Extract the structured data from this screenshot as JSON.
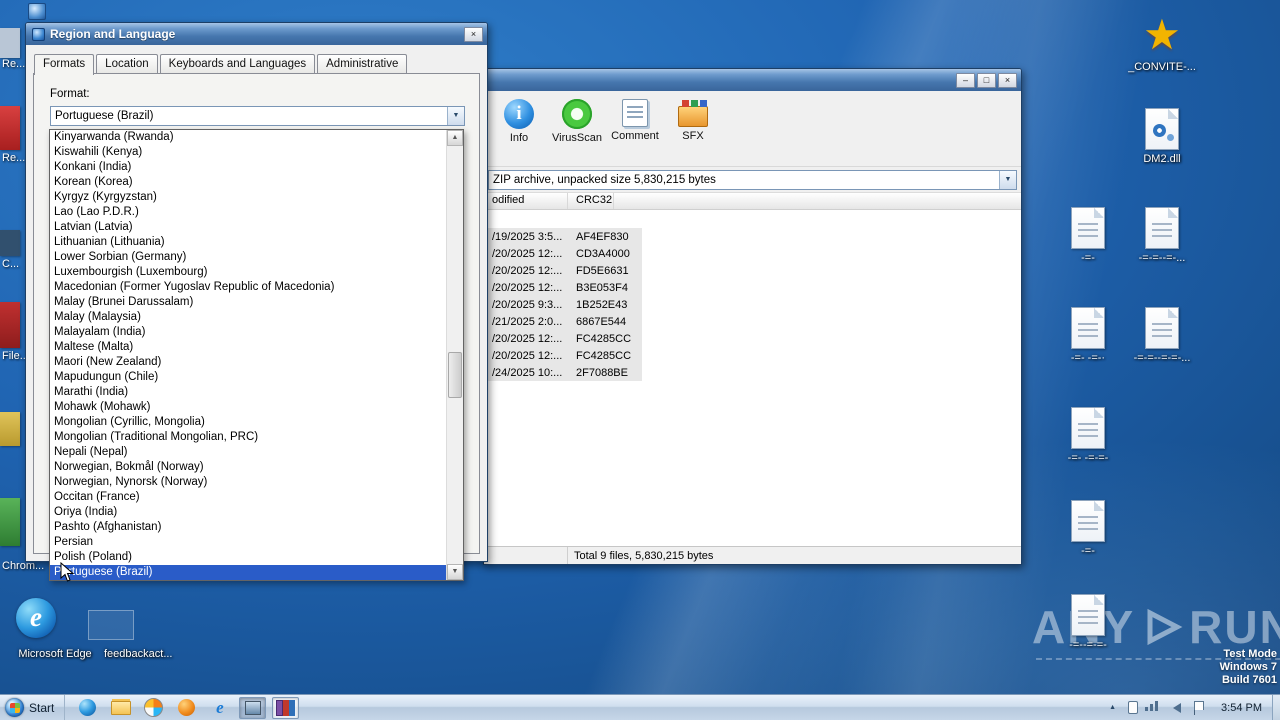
{
  "colors": {
    "desktop_blue": "#1f63b1",
    "selection_blue": "#2a5cc8",
    "titlebar_blue": "#4677ae",
    "taskbar_light": "#cfdeee"
  },
  "region_dialog": {
    "title": "Region and Language",
    "close_glyph": "×",
    "tabs": [
      {
        "label": "Formats"
      },
      {
        "label": "Location"
      },
      {
        "label": "Keyboards and Languages"
      },
      {
        "label": "Administrative"
      }
    ],
    "format_label": "Format:",
    "combo_value": "Portuguese (Brazil)",
    "combo_arrow": "▼",
    "scroll_up": "▲",
    "scroll_down": "▼",
    "list_items": [
      {
        "label": "Kinyarwanda (Rwanda)"
      },
      {
        "label": "Kiswahili (Kenya)"
      },
      {
        "label": "Konkani (India)"
      },
      {
        "label": "Korean (Korea)"
      },
      {
        "label": "Kyrgyz (Kyrgyzstan)"
      },
      {
        "label": "Lao (Lao P.D.R.)"
      },
      {
        "label": "Latvian (Latvia)"
      },
      {
        "label": "Lithuanian (Lithuania)"
      },
      {
        "label": "Lower Sorbian (Germany)"
      },
      {
        "label": "Luxembourgish (Luxembourg)"
      },
      {
        "label": "Macedonian (Former Yugoslav Republic of Macedonia)"
      },
      {
        "label": "Malay (Brunei Darussalam)"
      },
      {
        "label": "Malay (Malaysia)"
      },
      {
        "label": "Malayalam (India)"
      },
      {
        "label": "Maltese (Malta)"
      },
      {
        "label": "Maori (New Zealand)"
      },
      {
        "label": "Mapudungun (Chile)"
      },
      {
        "label": "Marathi (India)"
      },
      {
        "label": "Mohawk (Mohawk)"
      },
      {
        "label": "Mongolian (Cyrillic, Mongolia)"
      },
      {
        "label": "Mongolian (Traditional Mongolian, PRC)"
      },
      {
        "label": "Nepali (Nepal)"
      },
      {
        "label": "Norwegian, Bokmål (Norway)"
      },
      {
        "label": "Norwegian, Nynorsk (Norway)"
      },
      {
        "label": "Occitan (France)"
      },
      {
        "label": "Oriya (India)"
      },
      {
        "label": "Pashto (Afghanistan)"
      },
      {
        "label": "Persian"
      },
      {
        "label": "Polish (Poland)"
      },
      {
        "label": "Portuguese (Brazil)",
        "state": "selected"
      }
    ]
  },
  "archive_window": {
    "window_buttons": {
      "minimize": "–",
      "maximize": "□",
      "close": "×"
    },
    "toolbar": [
      {
        "label": "Info"
      },
      {
        "label": "VirusScan"
      },
      {
        "label": "Comment"
      },
      {
        "label": "SFX"
      }
    ],
    "address_value": "ZIP archive, unpacked size 5,830,215 bytes",
    "address_arrow": "▼",
    "columns": [
      {
        "label": "odified"
      },
      {
        "label": "CRC32"
      }
    ],
    "rows": [
      {
        "modified": "/19/2025 3:5...",
        "crc": "AF4EF830"
      },
      {
        "modified": "/20/2025 12:...",
        "crc": "CD3A4000"
      },
      {
        "modified": "/20/2025 12:...",
        "crc": "FD5E6631"
      },
      {
        "modified": "/20/2025 12:...",
        "crc": "B3E053F4"
      },
      {
        "modified": "/20/2025 9:3...",
        "crc": "1B252E43"
      },
      {
        "modified": "/21/2025 2:0...",
        "crc": "6867E544"
      },
      {
        "modified": "/20/2025 12:...",
        "crc": "FC4285CC"
      },
      {
        "modified": "/20/2025 12:...",
        "crc": "FC4285CC"
      },
      {
        "modified": "/24/2025 10:...",
        "crc": "2F7088BE"
      }
    ],
    "status": "Total 9 files, 5,830,215 bytes"
  },
  "desktop": {
    "left_items": [
      {
        "label": "Re..."
      },
      {
        "label": "Re..."
      },
      {
        "label": "C..."
      },
      {
        "label": "File..."
      },
      {
        "label": ""
      },
      {
        "label": "Chrom..."
      }
    ],
    "right_items": [
      {
        "label": "_CONVITE-...",
        "icon": "star"
      },
      {
        "label": "DM2.dll",
        "icon": "dll"
      },
      {
        "label": "-=-",
        "icon": "doc"
      },
      {
        "label": "-=-=--=-...",
        "icon": "doc"
      },
      {
        "label": "-=- -=-·",
        "icon": "doc"
      },
      {
        "label": "-=-=--=-=-...",
        "icon": "doc"
      },
      {
        "label": "-=- -=-=-",
        "icon": "doc"
      },
      {
        "label": "-=-",
        "icon": "doc"
      },
      {
        "label": "-=--=-=-",
        "icon": "doc"
      }
    ],
    "edge_label": "Microsoft Edge",
    "ghost_label": "feedbackact..."
  },
  "taskbar": {
    "start_label": "Start",
    "tray_expand": "▲",
    "time": "3:54 PM"
  },
  "watermark": {
    "left": "ANY",
    "right": "RUN"
  },
  "test_mode": {
    "line1": "Test Mode",
    "line2": "Windows 7",
    "line3": "Build 7601"
  }
}
